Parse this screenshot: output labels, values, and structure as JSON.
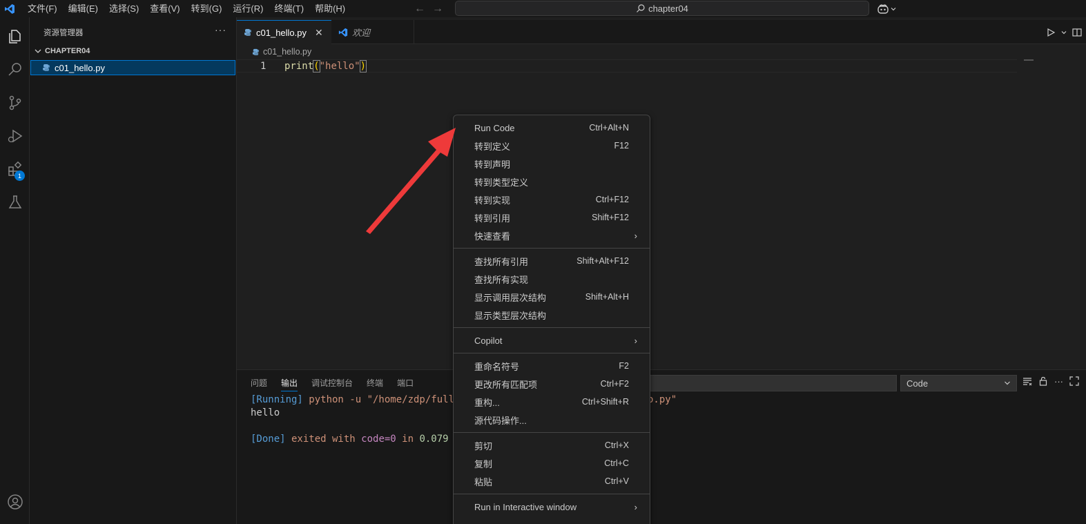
{
  "titlebar": {
    "menu": [
      "文件(F)",
      "编辑(E)",
      "选择(S)",
      "查看(V)",
      "转到(G)",
      "运行(R)",
      "终端(T)",
      "帮助(H)"
    ],
    "search": "chapter04"
  },
  "activitybar": {
    "extensions_badge": "1"
  },
  "sidebar": {
    "title": "资源管理器",
    "more": "···",
    "folder": "CHAPTER04",
    "file": "c01_hello.py"
  },
  "tabs": [
    {
      "label": "c01_hello.py",
      "close": "✕"
    },
    {
      "label": "欢迎"
    }
  ],
  "breadcrumb": "c01_hello.py",
  "editor": {
    "line_number": "1",
    "code_fn": "print",
    "code_open": "(",
    "code_str": "\"hello\"",
    "code_close": ")"
  },
  "panel": {
    "tabs": [
      "问题",
      "输出",
      "调试控制台",
      "终端",
      "端口"
    ],
    "channel": "Code",
    "output": {
      "l1_running": "[Running]",
      "l1_cmd": " python -u \"/home/zdp/full",
      "l1_tail": "o.py\"",
      "l2": "hello",
      "l4_done": "[Done]",
      "l4_exited": " exited with ",
      "l4_code": "code=0",
      "l4_in": " in ",
      "l4_num": "0.079"
    }
  },
  "context_menu": {
    "groups": [
      [
        {
          "label": "Run Code",
          "key": "Ctrl+Alt+N"
        },
        {
          "label": "转到定义",
          "key": "F12"
        },
        {
          "label": "转到声明",
          "key": ""
        },
        {
          "label": "转到类型定义",
          "key": ""
        },
        {
          "label": "转到实现",
          "key": "Ctrl+F12"
        },
        {
          "label": "转到引用",
          "key": "Shift+F12"
        },
        {
          "label": "快速查看",
          "key": "",
          "submenu": true
        }
      ],
      [
        {
          "label": "查找所有引用",
          "key": "Shift+Alt+F12"
        },
        {
          "label": "查找所有实现",
          "key": ""
        },
        {
          "label": "显示调用层次结构",
          "key": "Shift+Alt+H"
        },
        {
          "label": "显示类型层次结构",
          "key": ""
        }
      ],
      [
        {
          "label": "Copilot",
          "key": "",
          "submenu": true
        }
      ],
      [
        {
          "label": "重命名符号",
          "key": "F2"
        },
        {
          "label": "更改所有匹配项",
          "key": "Ctrl+F2"
        },
        {
          "label": "重构...",
          "key": "Ctrl+Shift+R"
        },
        {
          "label": "源代码操作...",
          "key": ""
        }
      ],
      [
        {
          "label": "剪切",
          "key": "Ctrl+X"
        },
        {
          "label": "复制",
          "key": "Ctrl+C"
        },
        {
          "label": "粘贴",
          "key": "Ctrl+V"
        }
      ],
      [
        {
          "label": "Run in Interactive window",
          "key": "",
          "submenu": true
        }
      ]
    ]
  },
  "colors": {
    "accent": "#0078d4",
    "annotation_arrow": "#ee3a3a"
  }
}
